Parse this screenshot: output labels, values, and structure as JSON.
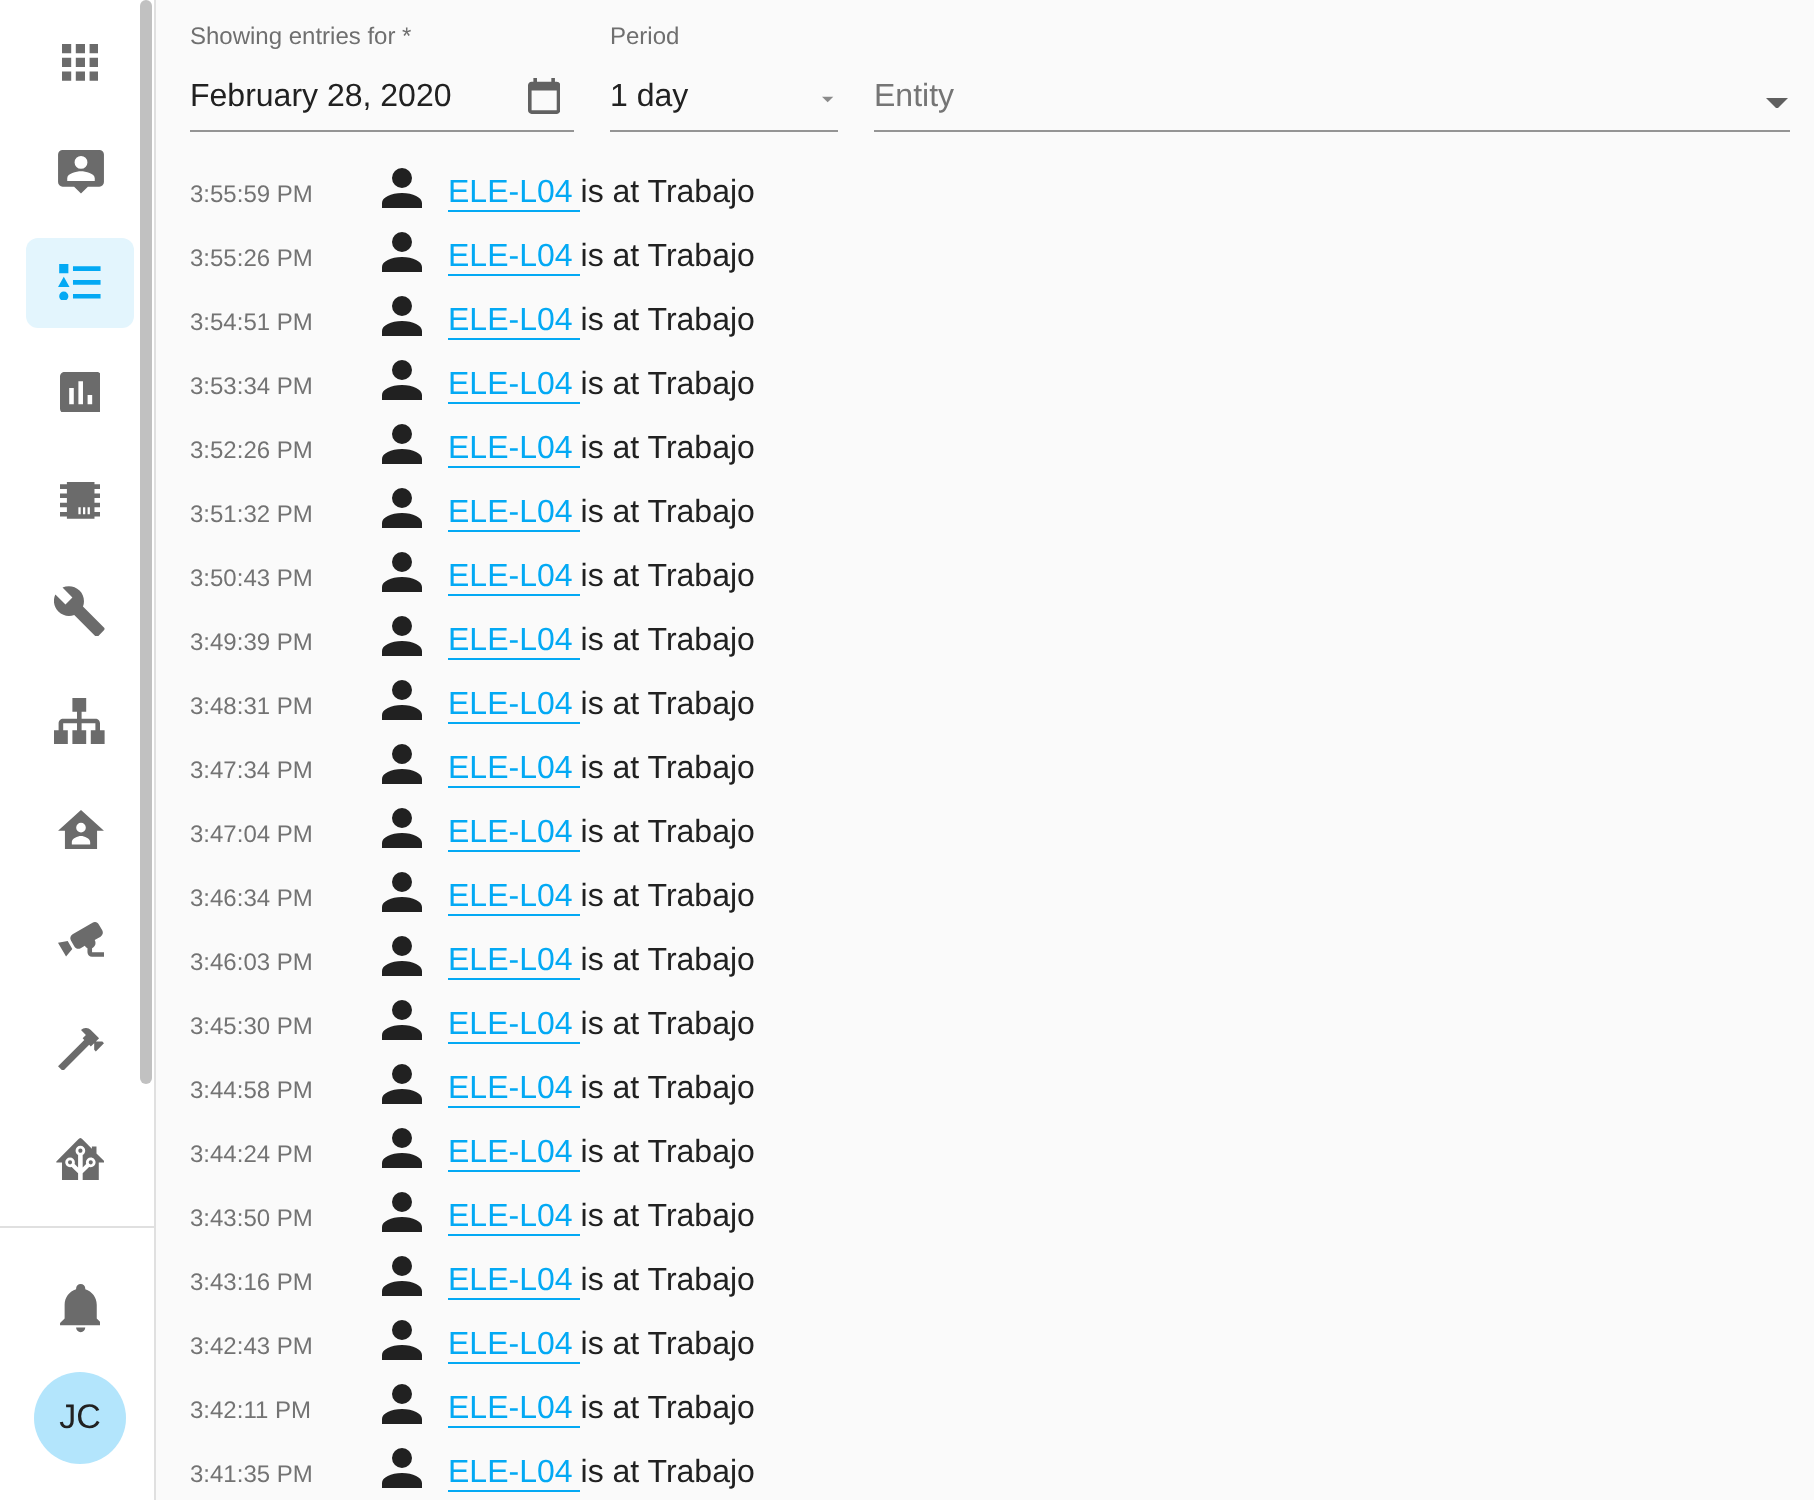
{
  "sidebar": {
    "items": [
      {
        "selected": false
      },
      {
        "selected": false
      },
      {
        "selected": true
      },
      {
        "selected": false
      },
      {
        "selected": false
      },
      {
        "selected": false
      },
      {
        "selected": false
      },
      {
        "selected": false
      },
      {
        "selected": false
      },
      {
        "selected": false
      },
      {
        "selected": false
      }
    ],
    "user_initials": "JC"
  },
  "filters": {
    "date": {
      "label": "Showing entries for *",
      "value": "February 28, 2020"
    },
    "period": {
      "label": "Period",
      "value": "1 day"
    },
    "entity": {
      "placeholder": "Entity"
    }
  },
  "entries": [
    {
      "time": "3:55:59 PM",
      "entity": "ELE-L04",
      "message": "is at Trabajo"
    },
    {
      "time": "3:55:26 PM",
      "entity": "ELE-L04",
      "message": "is at Trabajo"
    },
    {
      "time": "3:54:51 PM",
      "entity": "ELE-L04",
      "message": "is at Trabajo"
    },
    {
      "time": "3:53:34 PM",
      "entity": "ELE-L04",
      "message": "is at Trabajo"
    },
    {
      "time": "3:52:26 PM",
      "entity": "ELE-L04",
      "message": "is at Trabajo"
    },
    {
      "time": "3:51:32 PM",
      "entity": "ELE-L04",
      "message": "is at Trabajo"
    },
    {
      "time": "3:50:43 PM",
      "entity": "ELE-L04",
      "message": "is at Trabajo"
    },
    {
      "time": "3:49:39 PM",
      "entity": "ELE-L04",
      "message": "is at Trabajo"
    },
    {
      "time": "3:48:31 PM",
      "entity": "ELE-L04",
      "message": "is at Trabajo"
    },
    {
      "time": "3:47:34 PM",
      "entity": "ELE-L04",
      "message": "is at Trabajo"
    },
    {
      "time": "3:47:04 PM",
      "entity": "ELE-L04",
      "message": "is at Trabajo"
    },
    {
      "time": "3:46:34 PM",
      "entity": "ELE-L04",
      "message": "is at Trabajo"
    },
    {
      "time": "3:46:03 PM",
      "entity": "ELE-L04",
      "message": "is at Trabajo"
    },
    {
      "time": "3:45:30 PM",
      "entity": "ELE-L04",
      "message": "is at Trabajo"
    },
    {
      "time": "3:44:58 PM",
      "entity": "ELE-L04",
      "message": "is at Trabajo"
    },
    {
      "time": "3:44:24 PM",
      "entity": "ELE-L04",
      "message": "is at Trabajo"
    },
    {
      "time": "3:43:50 PM",
      "entity": "ELE-L04",
      "message": "is at Trabajo"
    },
    {
      "time": "3:43:16 PM",
      "entity": "ELE-L04",
      "message": "is at Trabajo"
    },
    {
      "time": "3:42:43 PM",
      "entity": "ELE-L04",
      "message": "is at Trabajo"
    },
    {
      "time": "3:42:11 PM",
      "entity": "ELE-L04",
      "message": "is at Trabajo"
    },
    {
      "time": "3:41:35 PM",
      "entity": "ELE-L04",
      "message": "is at Trabajo"
    }
  ]
}
